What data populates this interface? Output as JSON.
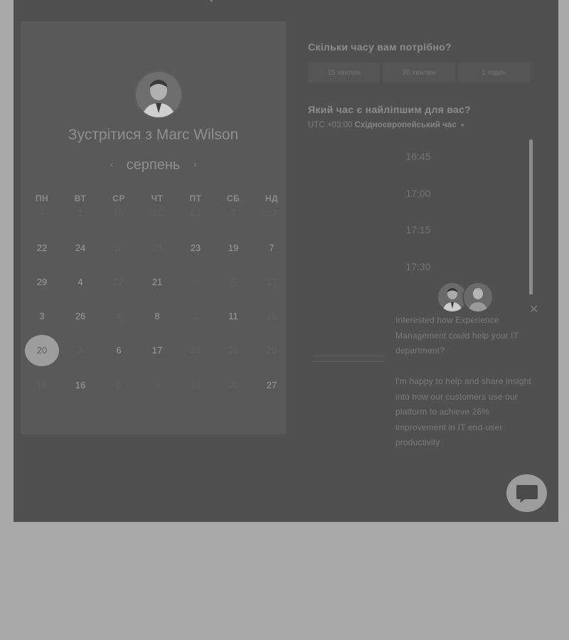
{
  "header": {
    "logo_icon": "speech-bubble-logo"
  },
  "calendar": {
    "title": "Зустрітися з Marc Wilson",
    "month": "серпень",
    "prev_icon": "chevron-left-icon",
    "next_icon": "chevron-right-icon",
    "weekdays": [
      "ПН",
      "ВТ",
      "СР",
      "ЧТ",
      "ПТ",
      "СБ",
      "НД"
    ],
    "weeks": [
      [
        {
          "d": "4",
          "a": false
        },
        {
          "d": "1",
          "a": false
        },
        {
          "d": "16",
          "a": false
        },
        {
          "d": "11",
          "a": false
        },
        {
          "d": "22",
          "a": false
        },
        {
          "d": "7",
          "a": false
        },
        {
          "d": "27",
          "a": false
        }
      ],
      [
        {
          "d": "22",
          "a": true
        },
        {
          "d": "24",
          "a": true
        },
        {
          "d": "16",
          "a": false
        },
        {
          "d": "25",
          "a": false
        },
        {
          "d": "23",
          "a": true
        },
        {
          "d": "19",
          "a": true
        },
        {
          "d": "7",
          "a": true
        }
      ],
      [
        {
          "d": "29",
          "a": true
        },
        {
          "d": "4",
          "a": true
        },
        {
          "d": "22",
          "a": false
        },
        {
          "d": "21",
          "a": true
        },
        {
          "d": "8",
          "a": false
        },
        {
          "d": "5",
          "a": false
        },
        {
          "d": "17",
          "a": false
        }
      ],
      [
        {
          "d": "3",
          "a": true
        },
        {
          "d": "26",
          "a": true
        },
        {
          "d": "4",
          "a": false
        },
        {
          "d": "8",
          "a": true
        },
        {
          "d": "3",
          "a": false
        },
        {
          "d": "11",
          "a": true
        },
        {
          "d": "26",
          "a": false
        }
      ],
      [
        {
          "d": "20",
          "a": true,
          "selected": true
        },
        {
          "d": "2",
          "a": false
        },
        {
          "d": "6",
          "a": true
        },
        {
          "d": "17",
          "a": true
        },
        {
          "d": "28",
          "a": false
        },
        {
          "d": "26",
          "a": false
        },
        {
          "d": "20",
          "a": false
        }
      ],
      [
        {
          "d": "16",
          "a": false
        },
        {
          "d": "16",
          "a": true
        },
        {
          "d": "0",
          "a": false
        },
        {
          "d": "5",
          "a": false
        },
        {
          "d": "18",
          "a": false
        },
        {
          "d": "20",
          "a": false
        },
        {
          "d": "27",
          "a": true
        }
      ]
    ]
  },
  "booking": {
    "duration_question": "Скільки часу вам потрібно?",
    "durations": [
      "15 хвилин",
      "30 хвилин",
      "1 годин"
    ],
    "time_question": "Який час є найліпшим для вас?",
    "tz_offset": "UTC +03:00",
    "tz_name": "Східноєвропейський час",
    "tz_caret": "▾",
    "times": [
      "16:45",
      "17:00",
      "17:15",
      "17:30"
    ]
  },
  "chat": {
    "message1": "Interested how Experience Management could help your IT department?",
    "message2": "I'm happy to help and share insight into how our customers use our platform to achieve 26% improvement in IT end-user productivity",
    "close_icon": "close-icon",
    "launcher_icon": "chat-bubble-icon"
  },
  "colors": {
    "overlay": "#a9a9a9",
    "modal_bg": "#505050",
    "panel_bg": "#595959"
  }
}
